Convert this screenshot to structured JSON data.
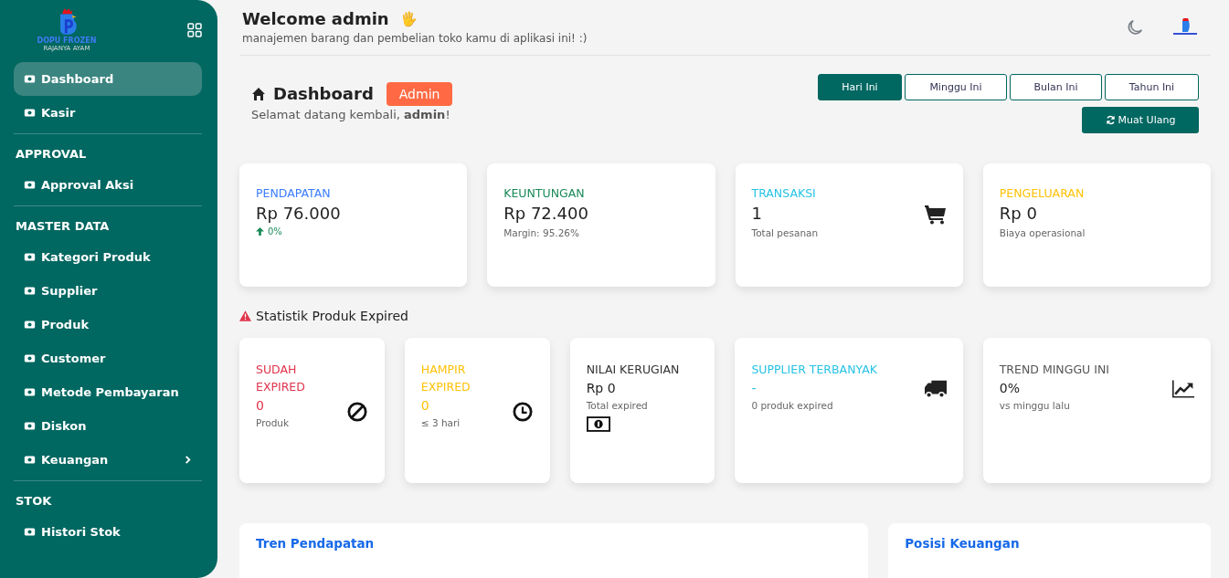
{
  "sidebar": {
    "logo": {
      "name": "DOPU FROZEN",
      "tagline": "RAJANYA AYAM"
    },
    "sections": [
      {
        "items": [
          {
            "label": "Dashboard",
            "selected": true,
            "has_submenu": false
          },
          {
            "label": "Kasir",
            "selected": false,
            "has_submenu": false
          }
        ]
      },
      {
        "title": "APPROVAL",
        "items": [
          {
            "label": "Approval Aksi",
            "selected": false,
            "has_submenu": false
          }
        ]
      },
      {
        "title": "MASTER DATA",
        "items": [
          {
            "label": "Kategori Produk",
            "selected": false,
            "has_submenu": false
          },
          {
            "label": "Supplier",
            "selected": false,
            "has_submenu": false
          },
          {
            "label": "Produk",
            "selected": false,
            "has_submenu": false
          },
          {
            "label": "Customer",
            "selected": false,
            "has_submenu": false
          },
          {
            "label": "Metode Pembayaran",
            "selected": false,
            "has_submenu": false
          },
          {
            "label": "Diskon",
            "selected": false,
            "has_submenu": false
          },
          {
            "label": "Keuangan",
            "selected": false,
            "has_submenu": true
          }
        ]
      },
      {
        "title": "STOK",
        "items": [
          {
            "label": "Histori Stok",
            "selected": false,
            "has_submenu": false
          }
        ]
      }
    ]
  },
  "topbar": {
    "title": "Welcome admin",
    "emoji": "🖐",
    "subtitle": "manajemen barang dan pembelian toko kamu di aplikasi ini! :)"
  },
  "page_header": {
    "title": "Dashboard",
    "badge": "Admin",
    "greeting": "Selamat datang kembali, **admin**!",
    "periods": [
      {
        "label": "Hari Ini",
        "selected": true
      },
      {
        "label": "Minggu Ini",
        "selected": false
      },
      {
        "label": "Bulan Ini",
        "selected": false
      },
      {
        "label": "Tahun Ini",
        "selected": false
      }
    ],
    "reload_button": "Muat Ulang"
  },
  "summary_cards": [
    {
      "label": "PENDAPATAN",
      "color": "#3b7cff",
      "value": "Rp 76.000",
      "value_tinted": false,
      "trend": "0%"
    },
    {
      "label": "KEUNTUNGAN",
      "color": "#1a8a5a",
      "value": "Rp 72.400",
      "value_tinted": false,
      "note": "Margin: 95.26%"
    },
    {
      "label": "TRANSAKSI",
      "color": "#27c3e6",
      "value": "1",
      "value_tinted": false,
      "note": "Total pesanan"
    },
    {
      "label": "PENGELUARAN",
      "color": "#ffc107",
      "value": "Rp 0",
      "value_tinted": false,
      "note": "Biaya operasional"
    }
  ],
  "expired_section": {
    "title": "Statistik Produk Expired",
    "cards": [
      {
        "label": "SUDAH EXPIRED",
        "color": "#e0344b",
        "value": "0",
        "value_tinted": true,
        "note": "Produk"
      },
      {
        "label": "HAMPIR EXPIRED",
        "color": "#ffc107",
        "value": "0",
        "value_tinted": true,
        "note": "≤ 3 hari"
      },
      {
        "label": "NILAI KERUGIAN",
        "color": "#333333",
        "value": "Rp 0",
        "value_tinted": false,
        "note": "Total expired"
      },
      {
        "label": "SUPPLIER TERBANYAK",
        "color": "#27c3e6",
        "value": "-",
        "value_tinted": true,
        "note": "0 produk expired"
      },
      {
        "label": "TREND MINGGU INI",
        "color": "#555555",
        "value": "0%",
        "value_tinted": false,
        "note": "vs minggu lalu"
      }
    ]
  },
  "panels": [
    {
      "title": "Tren Pendapatan"
    },
    {
      "title": "Posisi Keuangan"
    }
  ]
}
